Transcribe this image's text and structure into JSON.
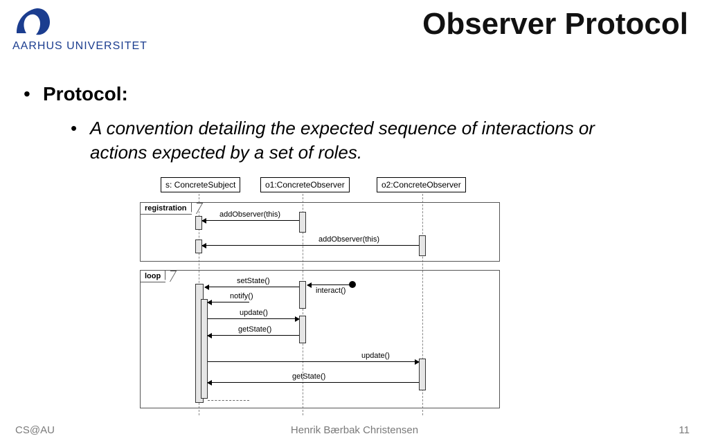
{
  "header": {
    "institution": "AARHUS UNIVERSITET",
    "title": "Observer Protocol"
  },
  "bullets": {
    "lvl1": "Protocol:",
    "lvl2": "A convention detailing the expected sequence of interactions or actions expected by a set of roles."
  },
  "diagram": {
    "participants": {
      "p0": "s: ConcreteSubject",
      "p1": "o1:ConcreteObserver",
      "p2": "o2:ConcreteObserver"
    },
    "frames": {
      "f0": "registration",
      "f1": "loop"
    },
    "messages": {
      "m_add1": "addObserver(this)",
      "m_add2": "addObserver(this)",
      "m_interact": "interact()",
      "m_setstate": "setState()",
      "m_notify": "notify()",
      "m_update1": "update()",
      "m_getstate1": "getState()",
      "m_update2": "update()",
      "m_getstate2": "getState()"
    }
  },
  "footer": {
    "left": "CS@AU",
    "center": "Henrik Bærbak Christensen",
    "page": "11"
  }
}
